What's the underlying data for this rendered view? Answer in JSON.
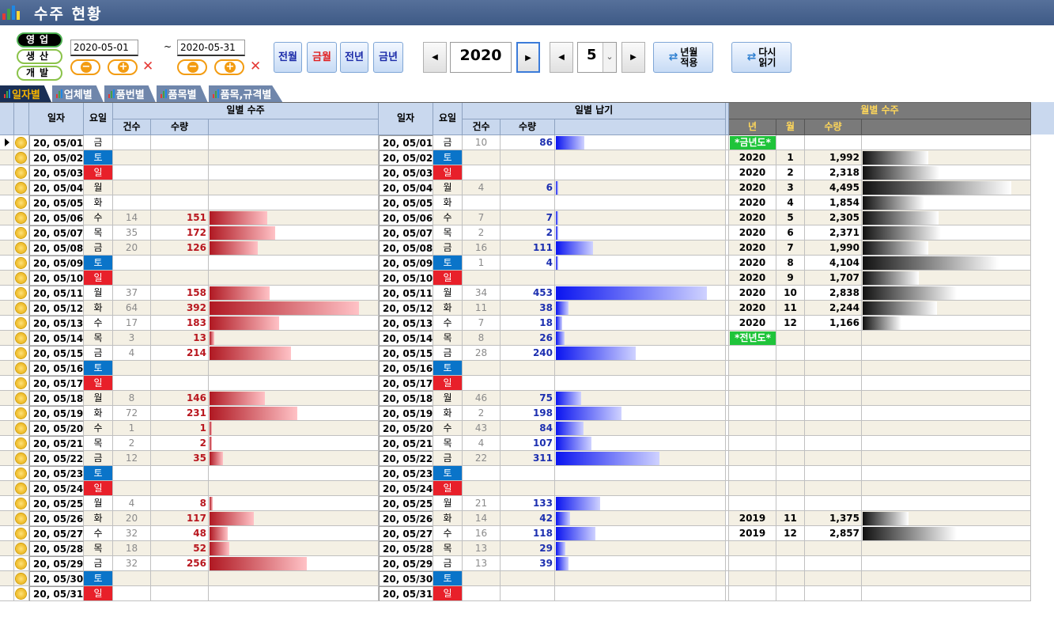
{
  "window": {
    "title": "수주 현황"
  },
  "dept": [
    {
      "label": "영업",
      "active": true
    },
    {
      "label": "생산",
      "active": false
    },
    {
      "label": "개발",
      "active": false
    }
  ],
  "period": {
    "from": "2020-05-01",
    "tilde": "~",
    "to": "2020-05-31"
  },
  "shortcuts": [
    {
      "label": "전월",
      "color": "#1a2aa8"
    },
    {
      "label": "금월",
      "color": "#e02020"
    },
    {
      "label": "전년",
      "color": "#1a2aa8"
    },
    {
      "label": "금년",
      "color": "#1a2aa8"
    }
  ],
  "year": "2020",
  "month": "5",
  "apply_btn": [
    "년월",
    "적용"
  ],
  "reload_btn": [
    "다시",
    "읽기"
  ],
  "tabs": [
    "일자별",
    "업체별",
    "품번별",
    "품목별",
    "품목,규격별"
  ],
  "headers": {
    "date": "일자",
    "day": "요일",
    "order": "일별 수주",
    "delivery": "일별 납기",
    "count": "건수",
    "qty": "수량",
    "monthly": "월별 수주",
    "year": "년",
    "month": "월"
  },
  "chart_data": {
    "type": "table",
    "daily": [
      {
        "date": "20, 05/01",
        "day": "금",
        "oc": "",
        "oq": "",
        "dc": "10",
        "dq": "86"
      },
      {
        "date": "20, 05/02",
        "day": "토",
        "oc": "",
        "oq": "",
        "dc": "",
        "dq": ""
      },
      {
        "date": "20, 05/03",
        "day": "일",
        "oc": "",
        "oq": "",
        "dc": "",
        "dq": ""
      },
      {
        "date": "20, 05/04",
        "day": "월",
        "oc": "",
        "oq": "",
        "dc": "4",
        "dq": "6"
      },
      {
        "date": "20, 05/05",
        "day": "화",
        "oc": "",
        "oq": "",
        "dc": "",
        "dq": ""
      },
      {
        "date": "20, 05/06",
        "day": "수",
        "oc": "14",
        "oq": "151",
        "dc": "7",
        "dq": "7"
      },
      {
        "date": "20, 05/07",
        "day": "목",
        "oc": "35",
        "oq": "172",
        "dc": "2",
        "dq": "2"
      },
      {
        "date": "20, 05/08",
        "day": "금",
        "oc": "20",
        "oq": "126",
        "dc": "16",
        "dq": "111"
      },
      {
        "date": "20, 05/09",
        "day": "토",
        "oc": "",
        "oq": "",
        "dc": "1",
        "dq": "4"
      },
      {
        "date": "20, 05/10",
        "day": "일",
        "oc": "",
        "oq": "",
        "dc": "",
        "dq": ""
      },
      {
        "date": "20, 05/11",
        "day": "월",
        "oc": "37",
        "oq": "158",
        "dc": "34",
        "dq": "453"
      },
      {
        "date": "20, 05/12",
        "day": "화",
        "oc": "64",
        "oq": "392",
        "dc": "11",
        "dq": "38"
      },
      {
        "date": "20, 05/13",
        "day": "수",
        "oc": "17",
        "oq": "183",
        "dc": "7",
        "dq": "18"
      },
      {
        "date": "20, 05/14",
        "day": "목",
        "oc": "3",
        "oq": "13",
        "dc": "8",
        "dq": "26"
      },
      {
        "date": "20, 05/15",
        "day": "금",
        "oc": "4",
        "oq": "214",
        "dc": "28",
        "dq": "240"
      },
      {
        "date": "20, 05/16",
        "day": "토",
        "oc": "",
        "oq": "",
        "dc": "",
        "dq": ""
      },
      {
        "date": "20, 05/17",
        "day": "일",
        "oc": "",
        "oq": "",
        "dc": "",
        "dq": ""
      },
      {
        "date": "20, 05/18",
        "day": "월",
        "oc": "8",
        "oq": "146",
        "dc": "46",
        "dq": "75"
      },
      {
        "date": "20, 05/19",
        "day": "화",
        "oc": "72",
        "oq": "231",
        "dc": "2",
        "dq": "198"
      },
      {
        "date": "20, 05/20",
        "day": "수",
        "oc": "1",
        "oq": "1",
        "dc": "43",
        "dq": "84"
      },
      {
        "date": "20, 05/21",
        "day": "목",
        "oc": "2",
        "oq": "2",
        "dc": "4",
        "dq": "107"
      },
      {
        "date": "20, 05/22",
        "day": "금",
        "oc": "12",
        "oq": "35",
        "dc": "22",
        "dq": "311"
      },
      {
        "date": "20, 05/23",
        "day": "토",
        "oc": "",
        "oq": "",
        "dc": "",
        "dq": ""
      },
      {
        "date": "20, 05/24",
        "day": "일",
        "oc": "",
        "oq": "",
        "dc": "",
        "dq": ""
      },
      {
        "date": "20, 05/25",
        "day": "월",
        "oc": "4",
        "oq": "8",
        "dc": "21",
        "dq": "133"
      },
      {
        "date": "20, 05/26",
        "day": "화",
        "oc": "20",
        "oq": "117",
        "dc": "14",
        "dq": "42"
      },
      {
        "date": "20, 05/27",
        "day": "수",
        "oc": "32",
        "oq": "48",
        "dc": "16",
        "dq": "118"
      },
      {
        "date": "20, 05/28",
        "day": "목",
        "oc": "18",
        "oq": "52",
        "dc": "13",
        "dq": "29"
      },
      {
        "date": "20, 05/29",
        "day": "금",
        "oc": "32",
        "oq": "256",
        "dc": "13",
        "dq": "39"
      },
      {
        "date": "20, 05/30",
        "day": "토",
        "oc": "",
        "oq": "",
        "dc": "",
        "dq": ""
      },
      {
        "date": "20, 05/31",
        "day": "일",
        "oc": "",
        "oq": "",
        "dc": "",
        "dq": ""
      }
    ],
    "monthly": [
      {
        "badge": "금년도"
      },
      {
        "year": "2020",
        "month": "1",
        "qty": "1,992"
      },
      {
        "year": "2020",
        "month": "2",
        "qty": "2,318"
      },
      {
        "year": "2020",
        "month": "3",
        "qty": "4,495"
      },
      {
        "year": "2020",
        "month": "4",
        "qty": "1,854"
      },
      {
        "year": "2020",
        "month": "5",
        "qty": "2,305"
      },
      {
        "year": "2020",
        "month": "6",
        "qty": "2,371"
      },
      {
        "year": "2020",
        "month": "7",
        "qty": "1,990"
      },
      {
        "year": "2020",
        "month": "8",
        "qty": "4,104"
      },
      {
        "year": "2020",
        "month": "9",
        "qty": "1,707"
      },
      {
        "year": "2020",
        "month": "10",
        "qty": "2,838"
      },
      {
        "year": "2020",
        "month": "11",
        "qty": "2,244"
      },
      {
        "year": "2020",
        "month": "12",
        "qty": "1,166"
      },
      {
        "badge": "전년도"
      },
      {},
      {},
      {},
      {},
      {},
      {},
      {},
      {},
      {},
      {},
      {},
      {
        "year": "2019",
        "month": "11",
        "qty": "1,375"
      },
      {
        "year": "2019",
        "month": "12",
        "qty": "2,857"
      },
      {},
      {},
      {},
      {},
      {}
    ]
  }
}
